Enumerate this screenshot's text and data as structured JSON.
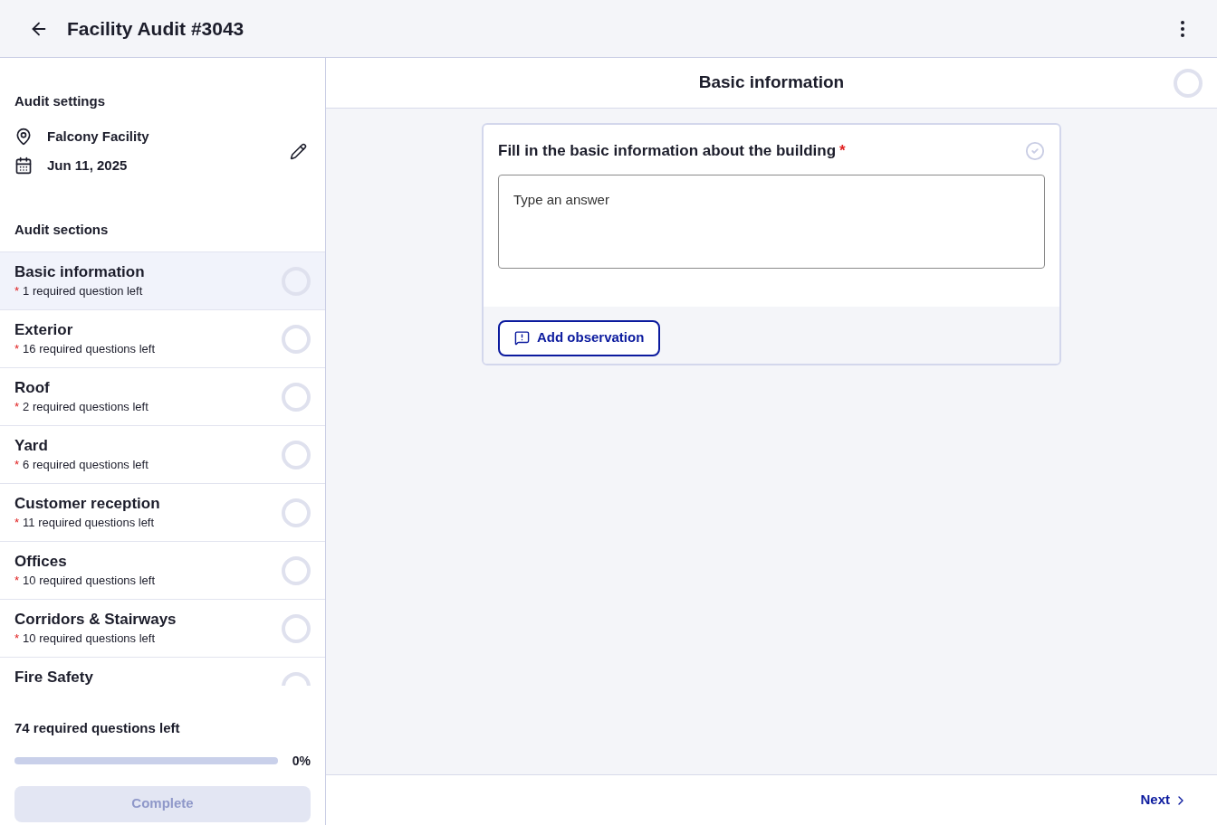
{
  "header": {
    "title": "Facility Audit #3043"
  },
  "sidebar": {
    "settings_title": "Audit settings",
    "facility": "Falcony Facility",
    "date": "Jun 11, 2025",
    "sections_title": "Audit sections",
    "sections": [
      {
        "name": "Basic information",
        "required_mark": "*",
        "required_left": "1 required question left",
        "selected": true
      },
      {
        "name": "Exterior",
        "required_mark": "*",
        "required_left": "16 required questions left",
        "selected": false
      },
      {
        "name": "Roof",
        "required_mark": "*",
        "required_left": "2 required questions left",
        "selected": false
      },
      {
        "name": "Yard",
        "required_mark": "*",
        "required_left": "6 required questions left",
        "selected": false
      },
      {
        "name": "Customer reception",
        "required_mark": "*",
        "required_left": "11 required questions left",
        "selected": false
      },
      {
        "name": "Offices",
        "required_mark": "*",
        "required_left": "10 required questions left",
        "selected": false
      },
      {
        "name": "Corridors & Stairways",
        "required_mark": "*",
        "required_left": "10 required questions left",
        "selected": false
      },
      {
        "name": "Fire Safety",
        "selected": false
      }
    ],
    "summary": "74 required questions left",
    "progress": {
      "level": 0,
      "reading": "0%"
    },
    "complete_button": {
      "label": "Complete",
      "disabled": true
    }
  },
  "main": {
    "section_title": "Basic information",
    "question": {
      "text": "Fill in the basic information about the building",
      "required_mark": "*",
      "placeholder": "Type an answer",
      "observation_button": "Add observation"
    },
    "next_button": "Next"
  }
}
